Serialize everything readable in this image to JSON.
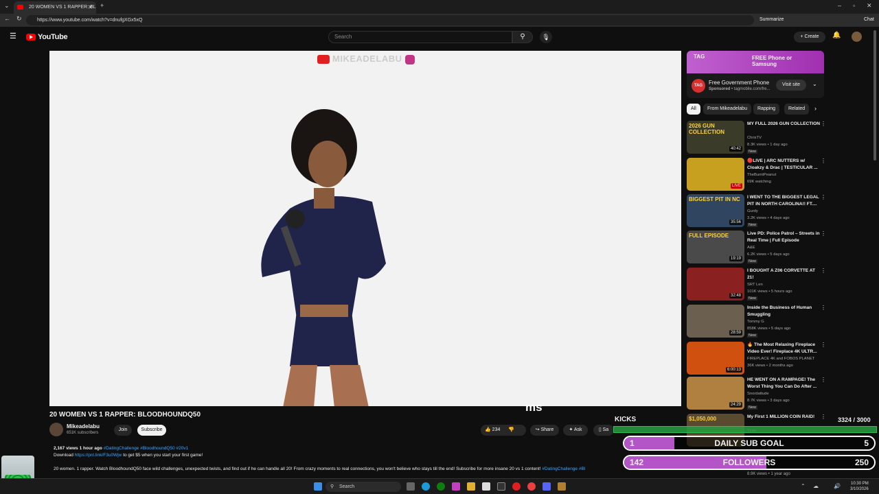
{
  "browser": {
    "tab_title": "20 WOMEN VS 1 RAPPER: BL",
    "url": "https://www.youtube.com/watch?v=dnufgXGx5xQ",
    "summarize": "Summarize",
    "chat": "Chat"
  },
  "header": {
    "logo": "YouTube",
    "search_placeholder": "Search",
    "create": "Create"
  },
  "video": {
    "watermark": "MIKEADELABU",
    "title": "20 WOMEN VS 1 RAPPER: BLOODHOUNDQ50",
    "channel": "Mikeadelabu",
    "subscribers": "651K subscribers",
    "join": "Join",
    "subscribe": "Subscribe",
    "likes": "234",
    "share": "Share",
    "ask": "Ask",
    "save": "Sa",
    "caption_fragment": "ms",
    "desc_meta": "2,167 views  1 hour ago",
    "desc_tags": "#DatingChallenge #BloodhoundQ50 #20v1",
    "desc_line2_a": "Download",
    "desc_link": "https://pnl.link/F3u0Wjw",
    "desc_line2_b": "to get $5 when you start your first game!",
    "desc_line3": "20 women. 1 rapper. Watch BloodhoundQ50 face wild challenges, unexpected twists, and find out if he can handle all 20! From crazy moments to real connections, you won't believe who stays till the end! Subscribe for more insane 20 vs 1 content!",
    "desc_line3_tag": "#DatingChallenge #Bl"
  },
  "ad": {
    "banner_text": "FREE Phone or Samsung",
    "title": "Free Government Phone",
    "sponsored": "Sponsored",
    "domain": "tagmobile.com/fre...",
    "visit": "Visit site",
    "logo": "TAG"
  },
  "chips": [
    "All",
    "From Mikeadelabu",
    "Rapping",
    "Related"
  ],
  "recommendations": [
    {
      "title": "MY FULL 2026 GUN COLLECTION",
      "channel": "ChrisTV",
      "meta": "8.3K views • 1 day ago",
      "badge": "New",
      "duration": "40:42",
      "thumb_text": "2026 GUN COLLECTION",
      "color": "#3b3b2a"
    },
    {
      "title": "🔴LIVE | ARC NUTTERS w/ Cloakzy & Drac | TESTICULAR ...",
      "channel": "TheBurntPeanut",
      "meta": "69K watching",
      "badge": "",
      "duration": "LIVE",
      "thumb_text": "",
      "color": "#c8a020"
    },
    {
      "title": "I WENT TO THE BIGGEST LEGAL PIT IN NORTH CAROLINA!! FT....",
      "channel": "Gurdy",
      "meta": "3.2K views • 4 days ago",
      "badge": "New",
      "duration": "35:56",
      "thumb_text": "BIGGEST PIT IN NC",
      "color": "#304560"
    },
    {
      "title": "Live PD: Police Patrol – Streets in Real Time | Full Episode",
      "channel": "A&E",
      "meta": "6.2K views • 5 days ago",
      "badge": "New",
      "duration": "19:19",
      "thumb_text": "FULL EPISODE",
      "color": "#4a4a4a"
    },
    {
      "title": "I BOUGHT A Z06 CORVETTE AT 21!",
      "channel": "SRT Len",
      "meta": "101K views • 5 hours ago",
      "badge": "New",
      "duration": "32:48",
      "thumb_text": "",
      "color": "#8a2020"
    },
    {
      "title": "Inside the Business of Human Smuggling",
      "channel": "Tommy G",
      "meta": "858K views • 5 days ago",
      "badge": "New",
      "duration": "28:59",
      "thumb_text": "",
      "color": "#6b6050"
    },
    {
      "title": "🔥 The Most Relaxing Fireplace Video Ever! Fireplace 4K ULTR...",
      "channel": "FIREPLACE 4K and FOBOS PLANET",
      "meta": "36K views • 2 months ago",
      "badge": "",
      "duration": "6:00:13",
      "thumb_text": "",
      "color": "#d05010"
    },
    {
      "title": "HE WENT ON A RAMPAGE! The Worst Thing You Can Do After ...",
      "channel": "Snordattude",
      "meta": "8.7K views • 3 days ago",
      "badge": "New",
      "duration": "24:29",
      "thumb_text": "",
      "color": "#b08040"
    },
    {
      "title": "My First 1 MILLION COIN RAID!",
      "channel": "TLee",
      "meta": "",
      "badge": "",
      "duration": "",
      "thumb_text": "$1,050,000",
      "color": "#5a4a30"
    }
  ],
  "overlay": {
    "kicks_label": "KICKS",
    "kicks_count": "3324",
    "kicks_goal": "/ 3000",
    "kicks_progress": 1.0,
    "sub_goal_current": "1",
    "sub_goal_label": "DAILY SUB GOAL",
    "sub_goal_target": "5",
    "sub_goal_progress": 0.2,
    "followers_current": "142",
    "followers_label": "FOLLOWERS",
    "followers_target": "250",
    "followers_progress": 0.57,
    "below_meta": "8.9K views • 1 year ago"
  },
  "taskbar": {
    "search": "Search",
    "time": "10:30 PM",
    "date": "3/10/2026"
  }
}
